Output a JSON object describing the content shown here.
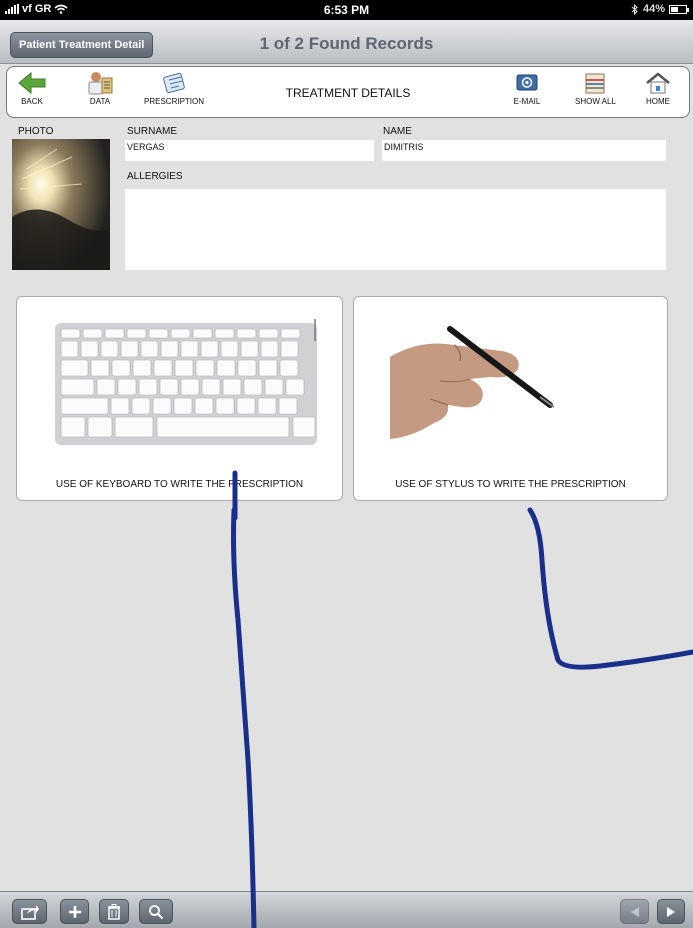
{
  "status_bar": {
    "carrier": "vf GR",
    "time": "6:53 PM",
    "battery": "44%",
    "battery_level": 0.44
  },
  "header": {
    "back_label": "Patient Treatment Detail",
    "record_title": "1 of 2 Found Records"
  },
  "toolbar": {
    "back": "BACK",
    "data": "DATA",
    "prescription": "PRESCRIPTION",
    "title": "TREATMENT DETAILS",
    "email": "E-MAIL",
    "show_all": "SHOW ALL",
    "home": "HOME"
  },
  "patient": {
    "photo_label": "PHOTO",
    "surname_label": "SURNAME",
    "surname": "VERGAS",
    "name_label": "NAME",
    "name": "DIMITRIS",
    "allergies_label": "ALLERGIES",
    "allergies": ""
  },
  "options": [
    {
      "caption": "USE OF KEYBOARD TO WRITE THE PRESCRIPTION"
    },
    {
      "caption": "USE OF STYLUS TO WRITE THE PRESCRIPTION"
    }
  ],
  "colors": {
    "annotation_ink": "#1a2f8a",
    "back_arrow": "#5aa63a"
  }
}
